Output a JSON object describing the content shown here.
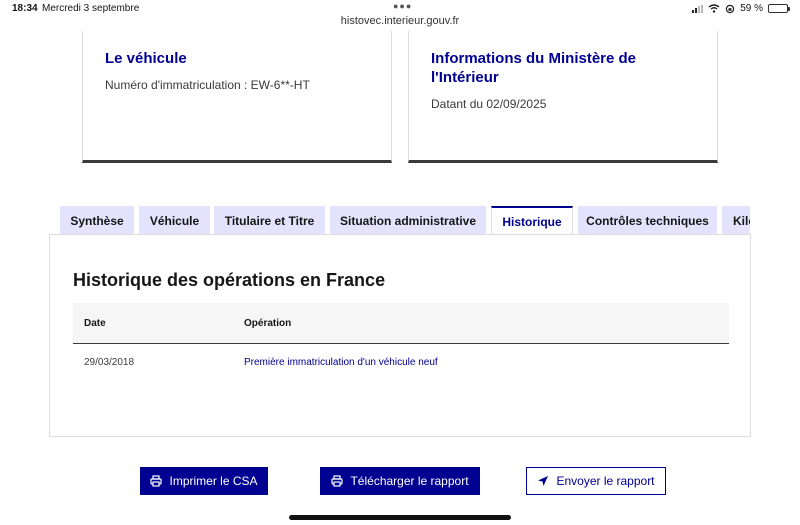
{
  "status_bar": {
    "time": "18:34",
    "date": "Mercredi 3 septembre",
    "url": "histovec.interieur.gouv.fr",
    "battery": "59 %",
    "battery_level": 0.59
  },
  "cards": [
    {
      "title": "Le véhicule",
      "text": "Numéro d'immatriculation : EW-6**-HT"
    },
    {
      "title": "Informations du Ministère de l'Intérieur",
      "text": "Datant du 02/09/2025"
    }
  ],
  "tabs": [
    {
      "label": "Synthèse"
    },
    {
      "label": "Véhicule"
    },
    {
      "label": "Titulaire et Titre"
    },
    {
      "label": "Situation administrative"
    },
    {
      "label": "Historique",
      "active": true
    },
    {
      "label": "Contrôles techniques"
    },
    {
      "label": "Kilométrage"
    }
  ],
  "history": {
    "title": "Historique des opérations en France",
    "columns": [
      "Date",
      "Opération"
    ],
    "rows": [
      {
        "date": "29/03/2018",
        "operation": "Première immatriculation d'un véhicule neuf"
      }
    ]
  },
  "actions": {
    "print": "Imprimer le CSA",
    "download": "Télécharger le rapport",
    "send": "Envoyer le rapport"
  },
  "colors": {
    "primary": "#000091",
    "tab_background": "#e3e3fd"
  }
}
